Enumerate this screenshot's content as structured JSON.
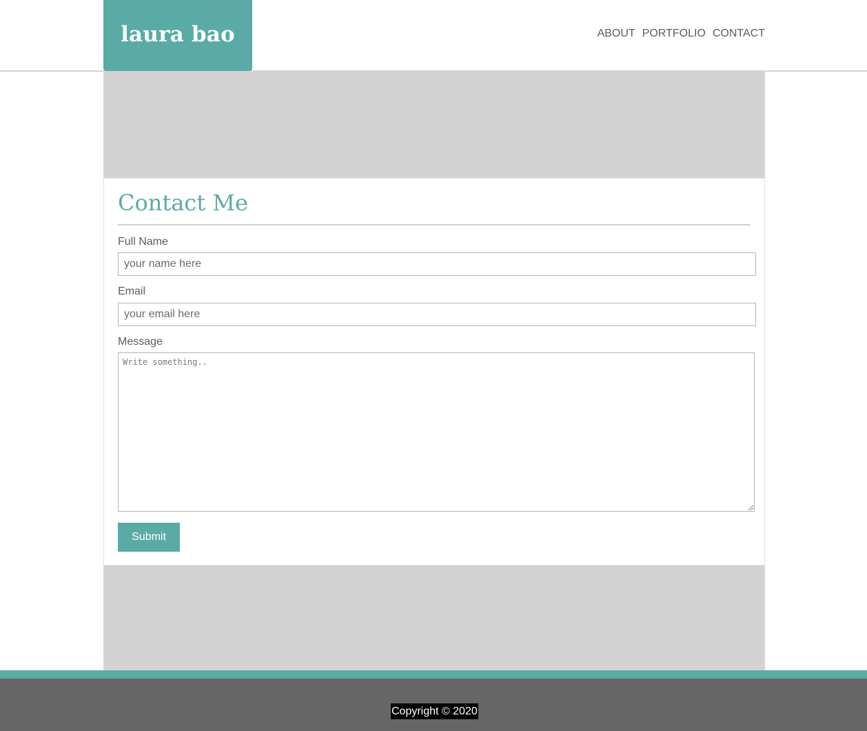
{
  "header": {
    "logo": "laura bao",
    "nav": [
      "ABOUT",
      "PORTFOLIO",
      "CONTACT"
    ]
  },
  "contact": {
    "title": "Contact Me",
    "name_label": "Full Name",
    "name_placeholder": "your name here",
    "email_label": "Email",
    "email_placeholder": "your email here",
    "message_label": "Message",
    "message_placeholder": "Write something..",
    "submit_label": "Submit"
  },
  "footer": {
    "copyright": "Copyright © 2020"
  },
  "colors": {
    "accent": "#5aaba6",
    "panel": "#d3d3d3",
    "footer": "#666666"
  }
}
